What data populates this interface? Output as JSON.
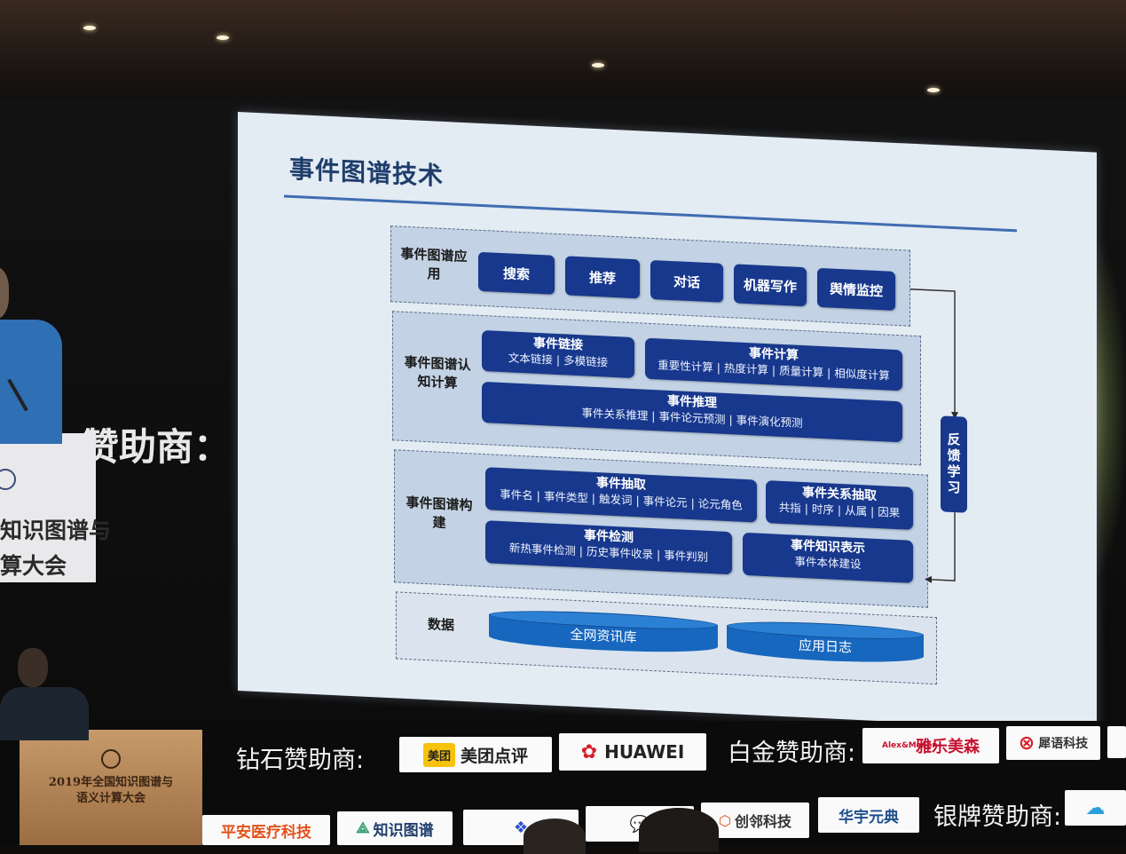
{
  "slide": {
    "title": "事件图谱技术",
    "layers": {
      "application": {
        "label": "事件图谱应用",
        "items": [
          "搜索",
          "推荐",
          "对话",
          "机器写作",
          "舆情监控"
        ]
      },
      "cognition": {
        "label": "事件图谱认知计算",
        "linking": {
          "title": "事件链接",
          "detail": "文本链接 | 多模链接"
        },
        "computing": {
          "title": "事件计算",
          "detail": "重要性计算 | 热度计算 | 质量计算 | 相似度计算"
        },
        "reasoning": {
          "title": "事件推理",
          "detail": "事件关系推理 | 事件论元预测 | 事件演化预测"
        }
      },
      "construction": {
        "label": "事件图谱构建",
        "extraction": {
          "title": "事件抽取",
          "detail": "事件名 | 事件类型 | 触发词 | 事件论元 | 论元角色"
        },
        "relation": {
          "title": "事件关系抽取",
          "detail": "共指 | 时序 | 从属 | 因果"
        },
        "detection": {
          "title": "事件检测",
          "detail": "新热事件检测 | 历史事件收录 | 事件判别"
        },
        "representation": {
          "title": "事件知识表示",
          "detail": "事件本体建设"
        }
      },
      "data": {
        "label": "数据",
        "stores": [
          "全网资讯库",
          "应用日志"
        ]
      }
    },
    "feedback": "反馈学习"
  },
  "led_wall": {
    "sponsor_fragment": "赞助商：",
    "conference_fragment_1": "知识图谱与",
    "conference_fragment_2": "算大会"
  },
  "podium": {
    "line1": "2019年全国知识图谱与",
    "line2": "语义计算大会"
  },
  "sponsors": {
    "diamond_label": "钻石赞助商:",
    "platinum_label": "白金赞助商:",
    "silver_label": "银牌赞助商:",
    "logos": {
      "meituan": "美团点评",
      "meituan_badge": "美团",
      "huawei": "HUAWEI",
      "alex_masen": "Alex&Masen",
      "yale": "雅乐美森",
      "xiyu": "犀语科技",
      "pingan": "平安医疗科技",
      "zhishi": "知识图谱",
      "chuangling": "创邻科技",
      "huayu": "华宇元典"
    }
  },
  "colors": {
    "slide_bg": "#e3ebf3",
    "box_blue": "#17388d",
    "title_blue": "#1f3d6b",
    "db_blue": "#1767bf"
  }
}
